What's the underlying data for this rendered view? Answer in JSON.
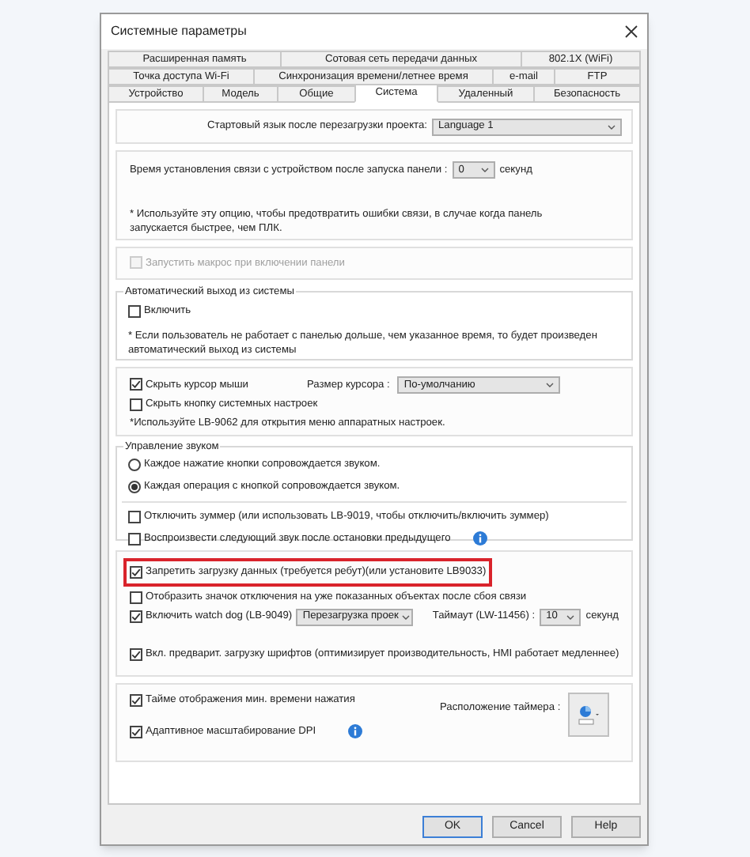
{
  "window": {
    "title": "Системные параметры"
  },
  "tab_rows": [
    [
      {
        "label": "Расширенная память",
        "selected": false
      },
      {
        "label": "Сотовая сеть передачи данных",
        "selected": false
      },
      {
        "label": "802.1X (WiFi)",
        "selected": false
      }
    ],
    [
      {
        "label": "Точка доступа Wi-Fi",
        "selected": false
      },
      {
        "label": "Синхронизация времени/летнее время",
        "selected": false
      },
      {
        "label": "e-mail",
        "selected": false
      },
      {
        "label": "FTP",
        "selected": false
      }
    ],
    [
      {
        "label": "Устройство",
        "selected": false
      },
      {
        "label": "Модель",
        "selected": false
      },
      {
        "label": "Общие",
        "selected": false
      },
      {
        "label": "Система",
        "selected": true
      },
      {
        "label": "Удаленный",
        "selected": false
      },
      {
        "label": "Безопасность",
        "selected": false
      }
    ]
  ],
  "startup_language": {
    "label": "Стартовый язык после перезагрузки проекта:",
    "value": "Language 1"
  },
  "connection_time": {
    "label": "Время установления связи с устройством после запуска панели :",
    "value": "0",
    "unit": "секунд",
    "note": "* Используйте эту опцию, чтобы предотвратить ошибки связи, в случае когда панель запускается быстрее, чем ПЛК."
  },
  "macro": {
    "label": "Запустить макрос при включении панели",
    "checked": false,
    "disabled": true
  },
  "auto_logout": {
    "title": "Автоматический выход из системы",
    "enable": {
      "label": "Включить",
      "checked": false
    },
    "note": "* Если пользователь не работает с панелью дольше, чем указанное время, то будет произведен автоматический выход из системы"
  },
  "cursor": {
    "hide_cursor": {
      "label": "Скрыть курсор мыши",
      "checked": true
    },
    "size_label": "Размер курсора :",
    "size_value": "По-умолчанию",
    "hide_settings_button": {
      "label": "Скрыть кнопку системных настроек",
      "checked": false
    },
    "note": "*Используйте LB-9062 для открытия меню аппаратных настроек."
  },
  "sound": {
    "title": "Управление звуком",
    "options": [
      {
        "label": "Каждое нажатие кнопки сопровождается звуком.",
        "selected": false
      },
      {
        "label": "Каждая операция с кнопкой сопровождается звуком.",
        "selected": true
      }
    ],
    "buzzer_off": {
      "label": "Отключить зуммер (или использовать LB-9019, чтобы отключить/включить зуммер)",
      "checked": false
    },
    "play_next": {
      "label": "Воспроизвести следующий звук после остановки предыдущего",
      "checked": false
    }
  },
  "data": {
    "block_download": {
      "label": "Запретить загрузку данных (требуется ребут)(или установите LB9033)",
      "checked": true,
      "highlighted": true
    },
    "show_disconnect_icon": {
      "label": "Отобразить значок отключения на уже показанных объектах после сбоя связи",
      "checked": false
    },
    "watchdog": {
      "label": "Включить watch dog (LB-9049)",
      "checked": true
    },
    "watchdog_action": "Перезагрузка проек",
    "timeout_label": "Таймаут (LW-11456) :",
    "timeout_value": "10",
    "timeout_unit": "секунд",
    "font_preload": {
      "label": "Вкл. предварит. загрузку шрифтов (оптимизирует производительность, HMI работает медленнее)",
      "checked": true
    }
  },
  "timer": {
    "show_time": {
      "label": "Тайме отображения мин. времени нажатия",
      "checked": true
    },
    "position_label": "Расположение таймера :",
    "dpi": {
      "label": "Адаптивное масштабирование DPI",
      "checked": true
    }
  },
  "buttons": [
    {
      "label": "OK",
      "default": true
    },
    {
      "label": "Cancel",
      "default": false
    },
    {
      "label": "Help",
      "default": false
    }
  ]
}
